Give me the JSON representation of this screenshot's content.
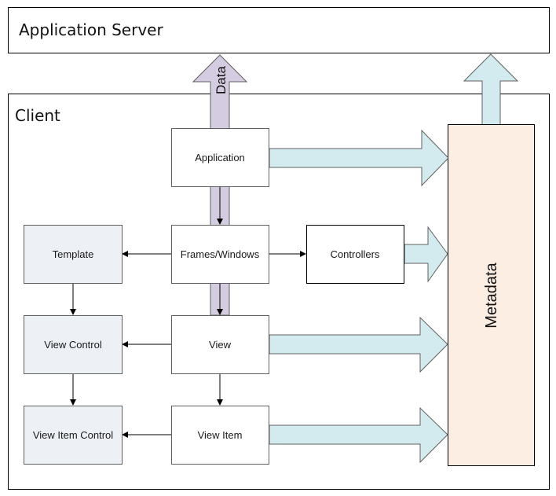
{
  "containers": {
    "server": {
      "label": "Application Server"
    },
    "client": {
      "label": "Client"
    }
  },
  "nodes": {
    "application": {
      "label": "Application"
    },
    "frames_windows": {
      "label": "Frames/Windows"
    },
    "controllers": {
      "label": "Controllers"
    },
    "template": {
      "label": "Template"
    },
    "view": {
      "label": "View"
    },
    "view_control": {
      "label": "View Control"
    },
    "view_item": {
      "label": "View Item"
    },
    "view_item_control": {
      "label": "View Item Control"
    },
    "metadata": {
      "label": "Metadata"
    }
  },
  "arrows": {
    "data": {
      "label": "Data"
    }
  },
  "edges": [
    {
      "from": "Application",
      "to": "Frames/Windows"
    },
    {
      "from": "Frames/Windows",
      "to": "View"
    },
    {
      "from": "Frames/Windows",
      "to": "Template"
    },
    {
      "from": "Frames/Windows",
      "to": "Controllers"
    },
    {
      "from": "Template",
      "to": "View Control"
    },
    {
      "from": "View Control",
      "to": "View Item Control"
    },
    {
      "from": "View",
      "to": "View Control"
    },
    {
      "from": "View",
      "to": "View Item"
    },
    {
      "from": "View Item",
      "to": "View Item Control"
    },
    {
      "from": "Application",
      "to": "Metadata"
    },
    {
      "from": "Controllers",
      "to": "Metadata"
    },
    {
      "from": "View",
      "to": "Metadata"
    },
    {
      "from": "View Item",
      "to": "Metadata"
    },
    {
      "from": "Metadata",
      "to": "Application Server"
    },
    {
      "from": "Client",
      "to": "Application Server",
      "label": "Data"
    }
  ],
  "colors": {
    "data_arrow": "#d4cce0",
    "metadata_arrow": "#d3eaef",
    "metadata_fill": "#fdeee3",
    "ui_box_fill": "#edf0f5",
    "box_border": "#707070"
  }
}
